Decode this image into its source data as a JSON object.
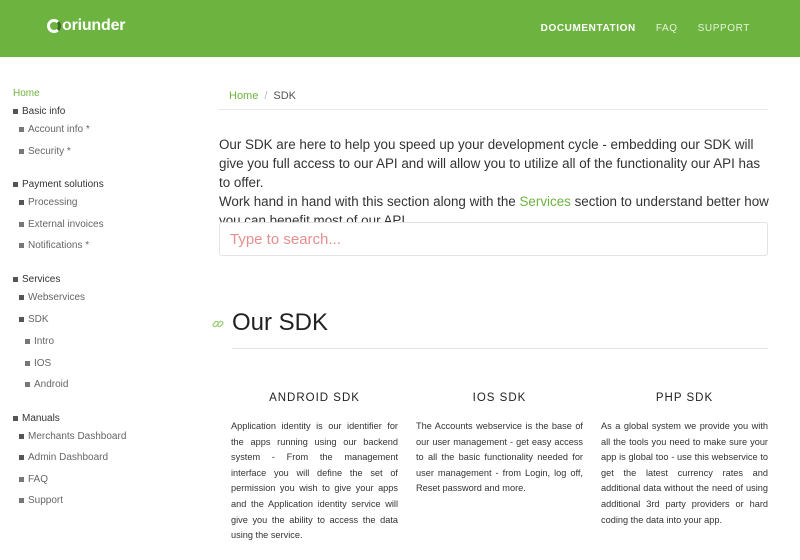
{
  "header": {
    "logo_text": "oriunder",
    "nav": [
      {
        "label": "DOCUMENTATION",
        "active": true
      },
      {
        "label": "FAQ",
        "active": false
      },
      {
        "label": "SUPPORT",
        "active": false
      }
    ],
    "brand_color": "#6db33f"
  },
  "sidebar": {
    "home": "Home",
    "items": [
      {
        "label": "Basic info"
      },
      {
        "label": "Account info *"
      },
      {
        "label": "Security *"
      },
      {
        "label": "Payment solutions"
      },
      {
        "label": "Processing"
      },
      {
        "label": "External invoices"
      },
      {
        "label": "Notifications *"
      },
      {
        "label": "Services"
      },
      {
        "label": "Webservices"
      },
      {
        "label": "SDK"
      },
      {
        "label": "Intro"
      },
      {
        "label": "IOS"
      },
      {
        "label": "Android"
      },
      {
        "label": "Manuals"
      },
      {
        "label": "Merchants Dashboard"
      },
      {
        "label": "Admin Dashboard"
      },
      {
        "label": "FAQ"
      },
      {
        "label": "Support"
      }
    ]
  },
  "breadcrumb": {
    "home": "Home",
    "separator": "/",
    "current": "SDK"
  },
  "intro": {
    "line1": "Our SDK are here to help you speed up your development cycle - embedding our SDK will give you full access to our API and will allow you to utilize all of the functionality our API has to offer.",
    "line2_before": "Work hand in hand with this section along with the ",
    "line2_link": "Services",
    "line2_after": " section to understand better how you can benefit most of our API."
  },
  "search": {
    "placeholder": "Type to search..."
  },
  "section": {
    "title": "Our SDK",
    "link_icon": "link-icon"
  },
  "columns": [
    {
      "title": "ANDROID SDK",
      "text": "Application identity is our identifier for the apps running using our backend system - From the management interface you will define the set of permission you wish to give your apps and the Application identity service will give you the ability to access the data using the service."
    },
    {
      "title": "IOS SDK",
      "text": "The Accounts webservice is the base of our user management - get easy access to all the basic functionality needed for user management - from Login, log off, Reset password and more."
    },
    {
      "title": "PHP SDK",
      "text": "As a global system we provide you with all the tools you need to make sure your app is global too - use this webservice to get the latest currency rates and additional data without the need of using additional 3rd party providers or hard coding the data into your app."
    }
  ]
}
